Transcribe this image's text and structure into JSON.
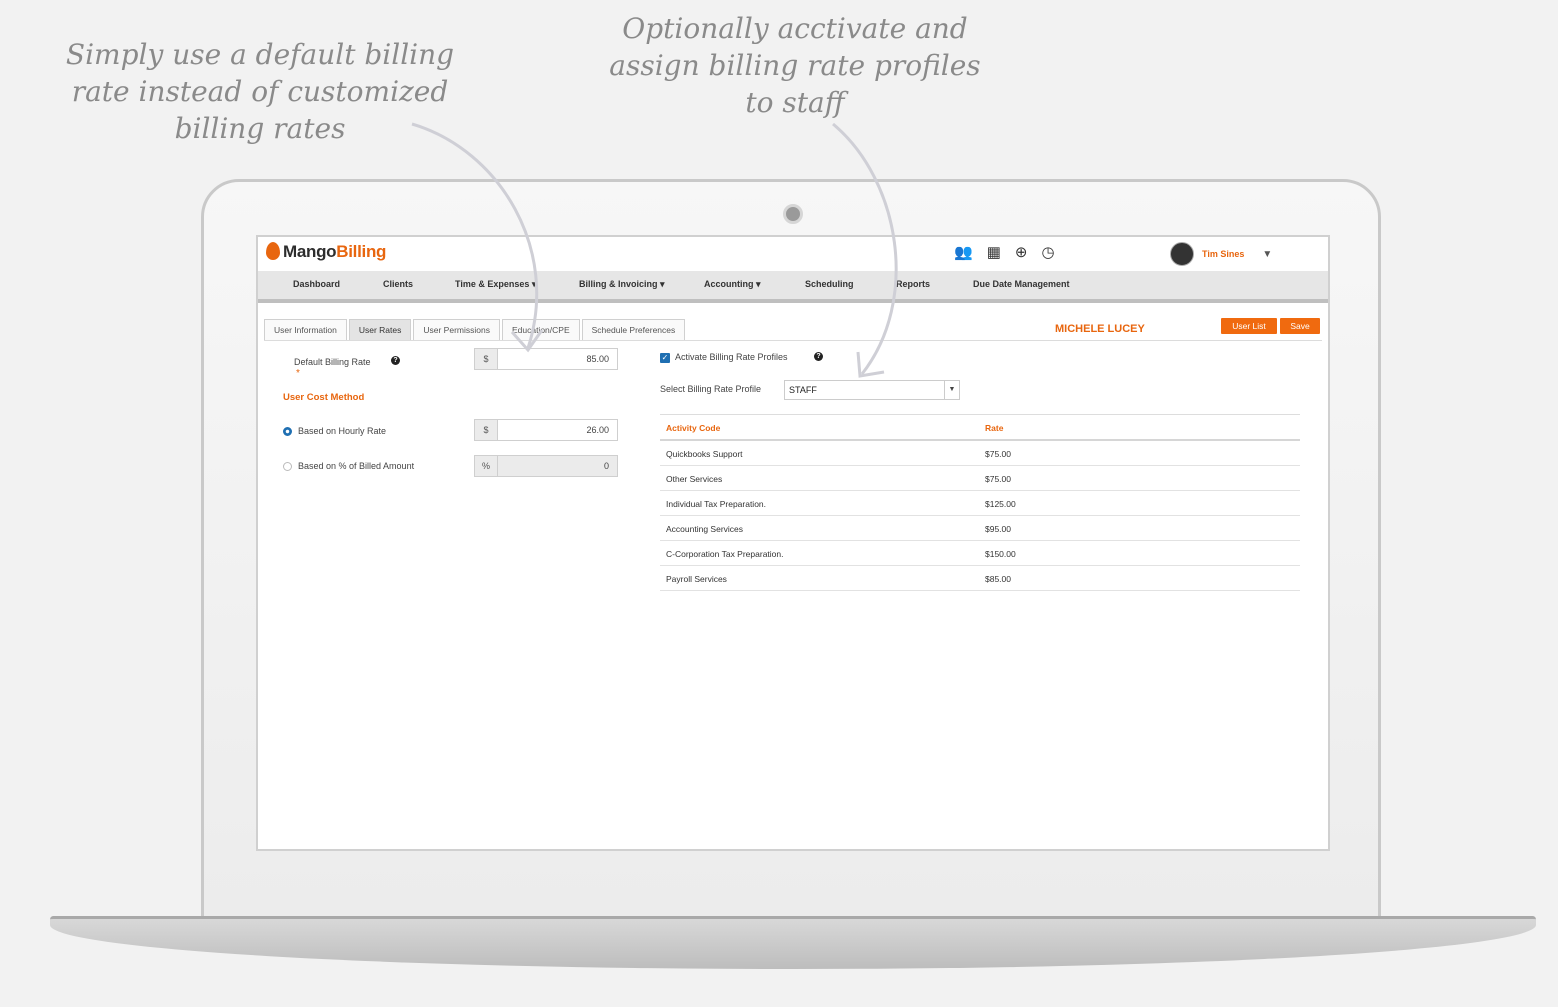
{
  "callouts": {
    "left": "Simply use a default billing rate instead of customized billing rates",
    "right": "Optionally acctivate and assign billing rate profiles to staff"
  },
  "header": {
    "logo_brand": "Mango",
    "logo_product": "Billing",
    "icons": [
      "users-icon",
      "calendar-icon",
      "plus-circle-icon",
      "clock-icon"
    ],
    "user_name": "Tim Sines"
  },
  "nav": {
    "items": [
      "Dashboard",
      "Clients",
      "Time & Expenses ▾",
      "Billing & Invoicing ▾",
      "Accounting ▾",
      "Scheduling",
      "Reports",
      "Due Date Management"
    ]
  },
  "tabs": [
    {
      "label": "User Information",
      "active": false
    },
    {
      "label": "User Rates",
      "active": true
    },
    {
      "label": "User Permissions",
      "active": false
    },
    {
      "label": "Education/CPE",
      "active": false
    },
    {
      "label": "Schedule Preferences",
      "active": false
    }
  ],
  "person_name": "MICHELE LUCEY",
  "buttons": {
    "user_list": "User List",
    "save": "Save"
  },
  "left_panel": {
    "default_billing_rate_label": "Default Billing Rate",
    "required_mark": "*",
    "default_billing_rate_prefix": "$",
    "default_billing_rate_value": "85.00",
    "cost_method_title": "User Cost Method",
    "hourly_label": "Based on Hourly Rate",
    "hourly_prefix": "$",
    "hourly_value": "26.00",
    "percent_label": "Based on % of Billed Amount",
    "percent_prefix": "%",
    "percent_value": "0",
    "selected_method": "hourly"
  },
  "right_panel": {
    "activate_label": "Activate Billing Rate Profiles",
    "activate_checked": true,
    "select_label": "Select Billing Rate Profile",
    "select_value": "STAFF",
    "table_headers": {
      "code": "Activity Code",
      "rate": "Rate"
    },
    "rows": [
      {
        "code": "Quickbooks Support",
        "rate": "$75.00"
      },
      {
        "code": "Other Services",
        "rate": "$75.00"
      },
      {
        "code": "Individual Tax Preparation.",
        "rate": "$125.00"
      },
      {
        "code": "Accounting Services",
        "rate": "$95.00"
      },
      {
        "code": "C-Corporation Tax Preparation.",
        "rate": "$150.00"
      },
      {
        "code": "Payroll Services",
        "rate": "$85.00"
      }
    ]
  },
  "colors": {
    "accent": "#e8660f",
    "button": "#f06a0f",
    "check": "#1f6fb2"
  }
}
